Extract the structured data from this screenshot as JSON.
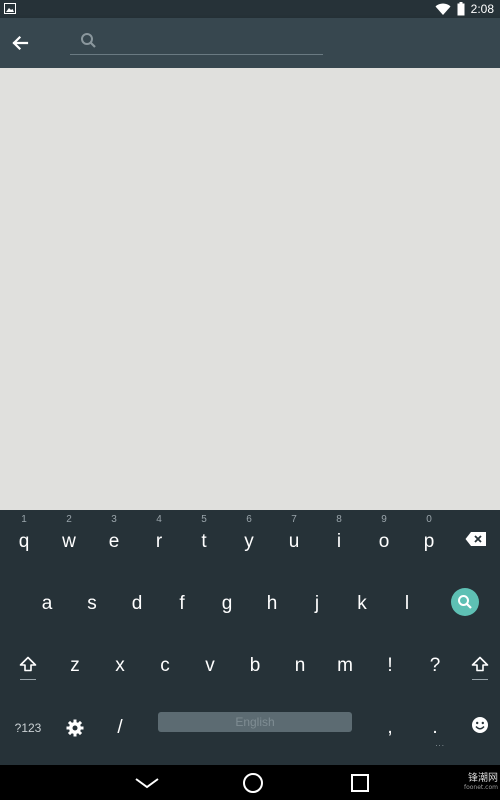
{
  "status_bar": {
    "time": "2:08",
    "icons": [
      "image-notification-icon",
      "wifi-icon",
      "battery-icon"
    ]
  },
  "toolbar": {
    "search_placeholder": "",
    "search_value": "",
    "icons": [
      "back-arrow-icon",
      "search-icon"
    ]
  },
  "keyboard": {
    "row1": [
      {
        "char": "q",
        "hint": "1"
      },
      {
        "char": "w",
        "hint": "2"
      },
      {
        "char": "e",
        "hint": "3"
      },
      {
        "char": "r",
        "hint": "4"
      },
      {
        "char": "t",
        "hint": "5"
      },
      {
        "char": "y",
        "hint": "6"
      },
      {
        "char": "u",
        "hint": "7"
      },
      {
        "char": "i",
        "hint": "8"
      },
      {
        "char": "o",
        "hint": "9"
      },
      {
        "char": "p",
        "hint": "0"
      }
    ],
    "row2": [
      "a",
      "s",
      "d",
      "f",
      "g",
      "h",
      "j",
      "k",
      "l"
    ],
    "row3": [
      "z",
      "x",
      "c",
      "v",
      "b",
      "n",
      "m",
      "!",
      "?"
    ],
    "symbols_label": "?123",
    "slash_label": "/",
    "space_label": "English",
    "comma_label": ",",
    "period_label": ".",
    "period_hint": "...",
    "accent_color": "#5ec0b4",
    "icons": [
      "backspace-icon",
      "keyboard-search-icon",
      "shift-icon",
      "settings-icon",
      "emoji-icon"
    ]
  },
  "nav_bar": {
    "icons": [
      "nav-back-icon",
      "nav-home-icon",
      "nav-recents-icon"
    ]
  },
  "watermark": {
    "brand": "锋潮网",
    "url": "foonet.com"
  }
}
